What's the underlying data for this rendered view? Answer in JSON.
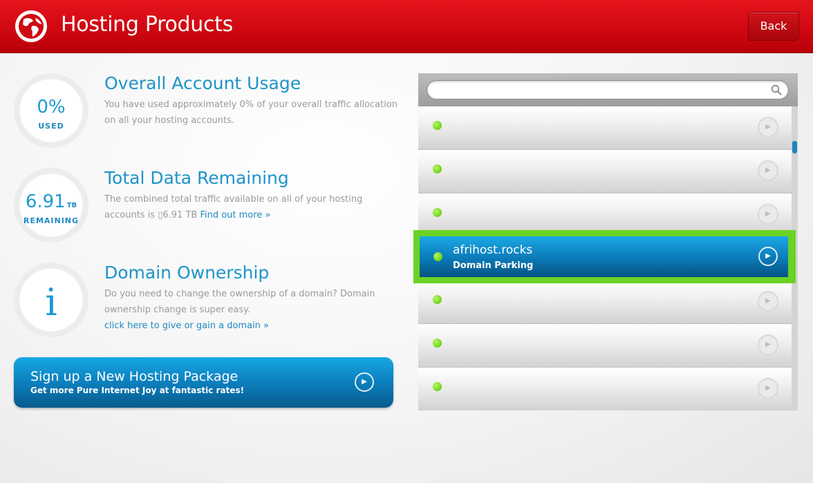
{
  "header": {
    "title": "Hosting Products",
    "back_label": "Back"
  },
  "usage": {
    "value": "0%",
    "sub": "USED",
    "title": "Overall Account Usage",
    "desc": "You have used approximately 0% of your overall traffic allocation on all your hosting accounts."
  },
  "data_remaining": {
    "value": "6.91",
    "unit": "TB",
    "sub": "REMAINING",
    "title": "Total Data Remaining",
    "desc": "The combined total traffic available on all of your hosting accounts is ▯6.91 TB",
    "link": "Find out more »"
  },
  "ownership": {
    "icon_glyph": "i",
    "title": "Domain Ownership",
    "desc": "Do you need to change the ownership of a domain? Domain ownership change is super easy.",
    "link": "click here to give or gain a domain »"
  },
  "signup": {
    "title": "Sign up a New Hosting Package",
    "subtitle": "Get more Pure Internet Joy at fantastic rates!"
  },
  "search": {
    "placeholder": "",
    "value": ""
  },
  "domains": {
    "highlighted": {
      "name": "afrihost.rocks",
      "type": "Domain Parking"
    },
    "rows_above": 3,
    "rows_below": 3
  },
  "colors": {
    "brand_red": "#d00812",
    "accent_blue": "#1d94c9",
    "status_green": "#6fd415",
    "highlight_border": "#6ad224"
  }
}
